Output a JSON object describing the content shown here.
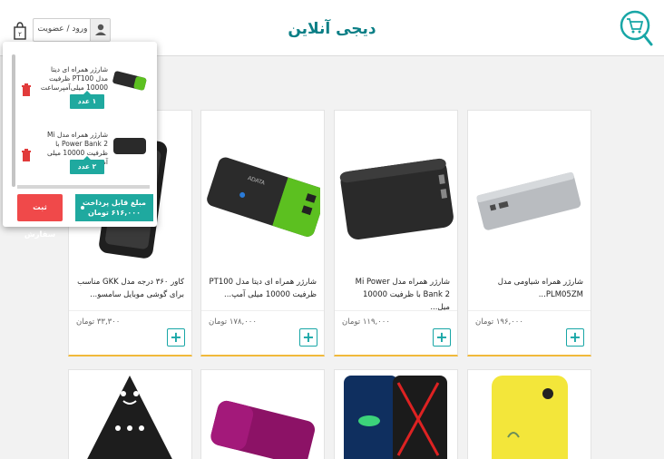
{
  "header": {
    "brand": "دیجی آنلاین",
    "login_label": "ورود / عضویت"
  },
  "cart": {
    "items": [
      {
        "title": "شارژر همراه ای دیتا مدل PT100 ظرفیت 10000 میلی‌آمپرساعت",
        "qty": "۱ عدد"
      },
      {
        "title": "شارژر همراه مدل Mi Power Bank 2 با ظرفیت 10000 میلی آمپرساعت",
        "qty": "۲ عدد"
      }
    ],
    "total_label": "مبلغ قابل پرداخت",
    "total_value": "۶۱۶,۰۰۰ تومان",
    "order_button": "ثبت سفارش"
  },
  "products": [
    {
      "title": "شارژر همراه شیاومی مدل PLM05ZM...",
      "price": "۱۹۶,۰۰۰ تومان",
      "add": "+"
    },
    {
      "title": "شارژر همراه مدل Mi Power Bank 2 با ظرفیت 10000 میل...",
      "price": "۱۱۹,۰۰۰ تومان",
      "add": "+"
    },
    {
      "title": "شارژر همراه ای دیتا مدل PT100 ظرفیت 10000 میلی آمپ...",
      "price": "۱۷۸,۰۰۰ تومان",
      "add": "+"
    },
    {
      "title": "کاور ۳۶۰ درجه مدل GKK مناسب برای گوشی موبایل سامسو...",
      "price": "۳۳,۳۰۰ تومان",
      "add": "+"
    }
  ],
  "colors": {
    "teal": "#1fa99f",
    "brand": "#0b7f86",
    "red": "#f0494a",
    "accent_border": "#f1b93b"
  }
}
